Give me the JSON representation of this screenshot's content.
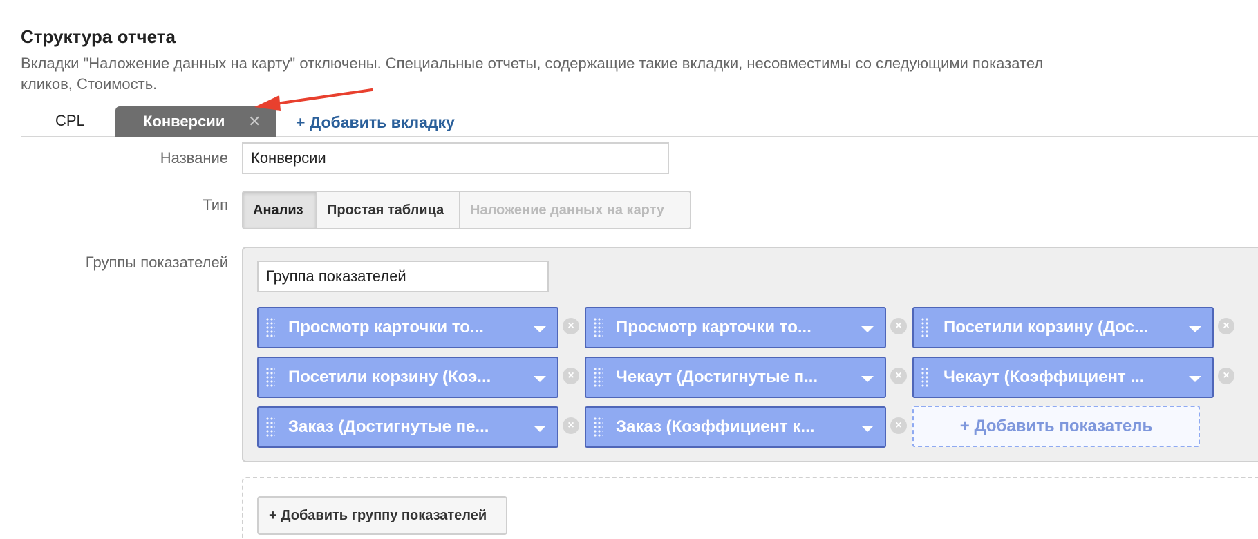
{
  "header": {
    "title": "Структура отчета",
    "description_line1": "Вкладки \"Наложение данных на карту\" отключены. Специальные отчеты, содержащие такие вкладки, несовместимы со следующими показател",
    "description_line2": "кликов, Стоимость."
  },
  "tabs": {
    "items": [
      {
        "label": "CPL"
      },
      {
        "label": "Конверсии",
        "close": "✕"
      }
    ],
    "add_label": "+ Добавить вкладку"
  },
  "form": {
    "name_label": "Название",
    "name_value": "Конверсии",
    "type_label": "Тип",
    "type_options": [
      "Анализ",
      "Простая таблица",
      "Наложение данных на карту"
    ],
    "type_selected": "Анализ",
    "groups_label": "Группы показателей"
  },
  "metric_group": {
    "name_value": "Группа показателей",
    "metrics": [
      {
        "label": "Просмотр карточки то..."
      },
      {
        "label": "Просмотр карточки то..."
      },
      {
        "label": "Посетили корзину (Дос..."
      },
      {
        "label": "Посетили корзину (Коэ..."
      },
      {
        "label": "Чекаут (Достигнутые п..."
      },
      {
        "label": "Чекаут (Коэффициент ..."
      },
      {
        "label": "Заказ (Достигнутые пе..."
      },
      {
        "label": "Заказ (Коэффициент к..."
      }
    ],
    "remove_glyph": "×",
    "add_metric_label": "+ Добавить показатель"
  },
  "add_group_label": "+ Добавить группу показателей",
  "colors": {
    "metric_fill": "#8faaf2",
    "metric_border": "#4f66b8",
    "active_tab": "#6e6e6e",
    "link": "#2a5f9a",
    "arrow": "#e8402e"
  }
}
